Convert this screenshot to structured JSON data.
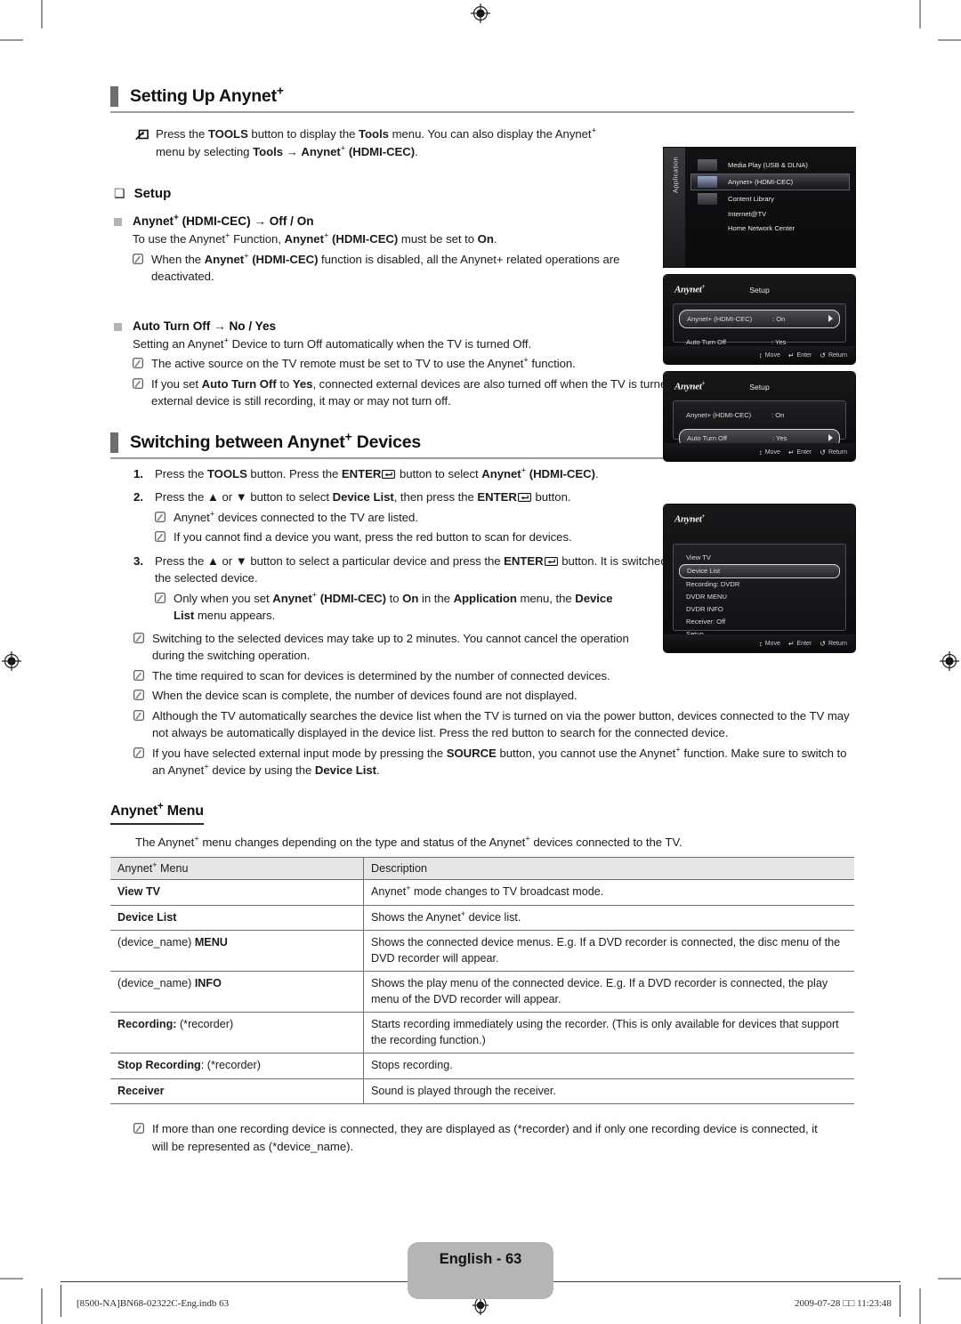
{
  "page": {
    "badge": "English - 63",
    "footer_left": "[8500-NA]BN68-02322C-Eng.indb   63",
    "footer_right": "2009-07-28   □□ 11:23:48"
  },
  "section1": {
    "title_pre": "Setting Up Anynet",
    "title_sup": "+",
    "tools_note": {
      "icon": "shortcut-icon",
      "line1_a": "Press the ",
      "line1_b": "TOOLS",
      "line1_c": " button to display the ",
      "line1_d": "Tools",
      "line1_e": " menu. You can also display the Anynet",
      "line1_sup": "+",
      "line2_a": "menu by selecting ",
      "line2_b": "Tools",
      "line2_c": " → ",
      "line2_d": "Anynet",
      "line2_sup": "+",
      "line2_e": " (HDMI-CEC)",
      "line2_f": "."
    },
    "setup_group": {
      "glyph": "❑",
      "label": "Setup"
    },
    "item1": {
      "label_a": "Anynet",
      "label_sup": "+",
      "label_b": " (HDMI-CEC) → Off / On",
      "body_a": "To use the Anynet",
      "body_sup": "+",
      "body_b": " Function, ",
      "body_c": "Anynet",
      "body_sup2": "+",
      "body_d": " (HDMI-CEC)",
      "body_e": " must be set to ",
      "body_f": "On",
      "body_g": ".",
      "note_a": "When the ",
      "note_b": "Anynet",
      "note_sup": "+",
      "note_c": " (HDMI-CEC)",
      "note_d": " function is disabled, all the Anynet+ related operations are deactivated."
    },
    "item2": {
      "label": "Auto Turn Off → No / Yes",
      "body_a": "Setting an Anynet",
      "body_sup": "+",
      "body_b": " Device to turn Off automatically when the TV is turned Off.",
      "note1_a": "The active source on the TV remote must be set to TV to use the Anynet",
      "note1_sup": "+",
      "note1_b": " function.",
      "note2_a": "If you set ",
      "note2_b": "Auto Turn Off",
      "note2_c": " to ",
      "note2_d": "Yes",
      "note2_e": ", connected external devices are also turned off when the TV is turned off. If an external device is still recording, it may or may not turn off."
    }
  },
  "section2": {
    "title_pre": "Switching between Anynet",
    "title_sup": "+",
    "title_post": " Devices",
    "steps": [
      {
        "num": "1.",
        "a": "Press the ",
        "b": "TOOLS",
        "c": " button. Press the ",
        "d": "ENTER",
        "e": " button to select ",
        "f": "Anynet",
        "sup": "+",
        "g": " (HDMI-CEC)",
        "h": "."
      },
      {
        "num": "2.",
        "a": "Press the ▲ or ▼ button to select ",
        "b": "Device List",
        "c": ", then press the ",
        "d": "ENTER",
        "e": " button.",
        "f": "",
        "sup": "",
        "g": "",
        "h": ""
      },
      {
        "num": "3.",
        "a": "Press the ▲ or ▼ button to select a particular device and press the ",
        "b": "",
        "c": "",
        "d": "ENTER",
        "e": " button. It is switched to the selected device.",
        "f": "",
        "sup": "",
        "g": "",
        "h": ""
      }
    ],
    "step2_notes": [
      {
        "a": "Anynet",
        "sup": "+",
        "b": " devices connected to the TV are listed."
      },
      {
        "a": "If you cannot find a device you want, press the red button to scan for devices.",
        "sup": "",
        "b": ""
      }
    ],
    "step3_note": {
      "a": "Only when you set ",
      "b": "Anynet",
      "sup": "+",
      "c": " (HDMI-CEC)",
      "d": " to ",
      "e": "On",
      "f": " in the ",
      "g": "Application",
      "h": " menu, the ",
      "i": "Device List",
      "j": " menu appears."
    },
    "notes": [
      "Switching to the selected devices may take up to 2 minutes. You cannot cancel the operation during the switching operation.",
      "The time required to scan for devices is determined by the number of connected devices.",
      "When the device scan is complete, the number of devices found are not displayed.",
      "Although the TV automatically searches the device list when the TV is turned on via the power button, devices connected to the TV may not always be automatically displayed in the device list. Press the red button to search for the connected device."
    ],
    "note_source": {
      "a": "If you have selected external input mode by pressing the ",
      "b": "SOURCE",
      "c": " button, you cannot use the Anynet",
      "sup": "+",
      "d": " function. Make sure to switch to an Anynet",
      "sup2": "+",
      "e": " device by using the ",
      "f": "Device List",
      "g": "."
    }
  },
  "section3": {
    "title_pre": "Anynet",
    "title_sup": "+",
    "title_post": " Menu",
    "intro_a": "The Anynet",
    "intro_sup": "+",
    "intro_b": " menu changes depending on the type and status of the Anynet",
    "intro_sup2": "+",
    "intro_c": " devices connected to the TV.",
    "table": {
      "headers": [
        "Anynet⁺ Menu",
        "Description"
      ],
      "header_col1_pre": "Anynet",
      "header_col1_sup": "+",
      "header_col1_post": " Menu",
      "header_col2": "Description",
      "rows": [
        {
          "menu_bold": "View TV",
          "menu_dim": "",
          "desc_a": "Anynet",
          "desc_sup": "+",
          "desc_b": " mode changes to TV broadcast mode."
        },
        {
          "menu_bold": "Device List",
          "menu_dim": "",
          "desc_a": "Shows the Anynet",
          "desc_sup": "+",
          "desc_b": " device list."
        },
        {
          "menu_bold": "MENU",
          "menu_dim": "(device_name) ",
          "desc_a": "Shows the connected device menus. E.g. If a DVD recorder is connected, the disc menu of the DVD recorder will appear.",
          "desc_sup": "",
          "desc_b": ""
        },
        {
          "menu_bold": "INFO",
          "menu_dim": "(device_name) ",
          "desc_a": "Shows the play menu of the connected device. E.g. If a DVD recorder is connected, the play menu of the DVD recorder will appear.",
          "desc_sup": "",
          "desc_b": ""
        },
        {
          "menu_bold": "Recording:",
          "menu_dim": " (*recorder)",
          "desc_a": "Starts recording immediately using the recorder. (This is only available for devices that support the recording function.)",
          "desc_sup": "",
          "desc_b": ""
        },
        {
          "menu_bold": "Stop Recording",
          "menu_dim": ": (*recorder)",
          "desc_a": "Stops recording.",
          "desc_sup": "",
          "desc_b": ""
        },
        {
          "menu_bold": "Receiver",
          "menu_dim": "",
          "desc_a": "Sound is played through the receiver.",
          "desc_sup": "",
          "desc_b": ""
        }
      ]
    },
    "final_note": "If more than one recording device is connected, they are displayed as (*recorder) and if only one recording device is connected, it will be represented as (*device_name)."
  },
  "screenshots": {
    "application": {
      "sidebar_label": "Application",
      "items": [
        {
          "label": "Media Play (USB & DLNA)",
          "selected": false,
          "has_icon": true
        },
        {
          "label": "Anynet+ (HDMI-CEC)",
          "selected": true,
          "has_icon": true
        },
        {
          "label": "Content Library",
          "selected": false,
          "has_icon": true
        },
        {
          "label": "Internet@TV",
          "selected": false,
          "has_icon": false
        },
        {
          "label": "Home Network Center",
          "selected": false,
          "has_icon": false
        }
      ]
    },
    "setup1": {
      "brand": "Anynet",
      "brand_sup": "+",
      "title": "Setup",
      "options": [
        {
          "label": "Anynet+ (HDMI-CEC)",
          "value": ": On",
          "selected": true
        },
        {
          "label": "Auto Turn Off",
          "value": ": Yes",
          "selected": false
        }
      ],
      "footer": [
        {
          "glyph": "↕",
          "label": "Move"
        },
        {
          "glyph": "↵",
          "label": "Enter"
        },
        {
          "glyph": "↺",
          "label": "Return"
        }
      ]
    },
    "setup2": {
      "brand": "Anynet",
      "brand_sup": "+",
      "title": "Setup",
      "options": [
        {
          "label": "Anynet+ (HDMI-CEC)",
          "value": ": On",
          "selected": false
        },
        {
          "label": "Auto Turn Off",
          "value": ": Yes",
          "selected": true
        }
      ],
      "footer": [
        {
          "glyph": "↕",
          "label": "Move"
        },
        {
          "glyph": "↵",
          "label": "Enter"
        },
        {
          "glyph": "↺",
          "label": "Return"
        }
      ]
    },
    "devicelist": {
      "brand": "Anynet",
      "brand_sup": "+",
      "items": [
        {
          "label": "View TV",
          "selected": false
        },
        {
          "label": "Device List",
          "selected": true
        },
        {
          "label": "Recording: DVDR",
          "selected": false
        },
        {
          "label": "DVDR MENU",
          "selected": false
        },
        {
          "label": "DVDR INFO",
          "selected": false
        },
        {
          "label": "Receiver: Off",
          "selected": false
        },
        {
          "label": "Setup",
          "selected": false
        }
      ],
      "footer": [
        {
          "glyph": "↕",
          "label": "Move"
        },
        {
          "glyph": "↵",
          "label": "Enter"
        },
        {
          "glyph": "↺",
          "label": "Return"
        }
      ]
    }
  }
}
